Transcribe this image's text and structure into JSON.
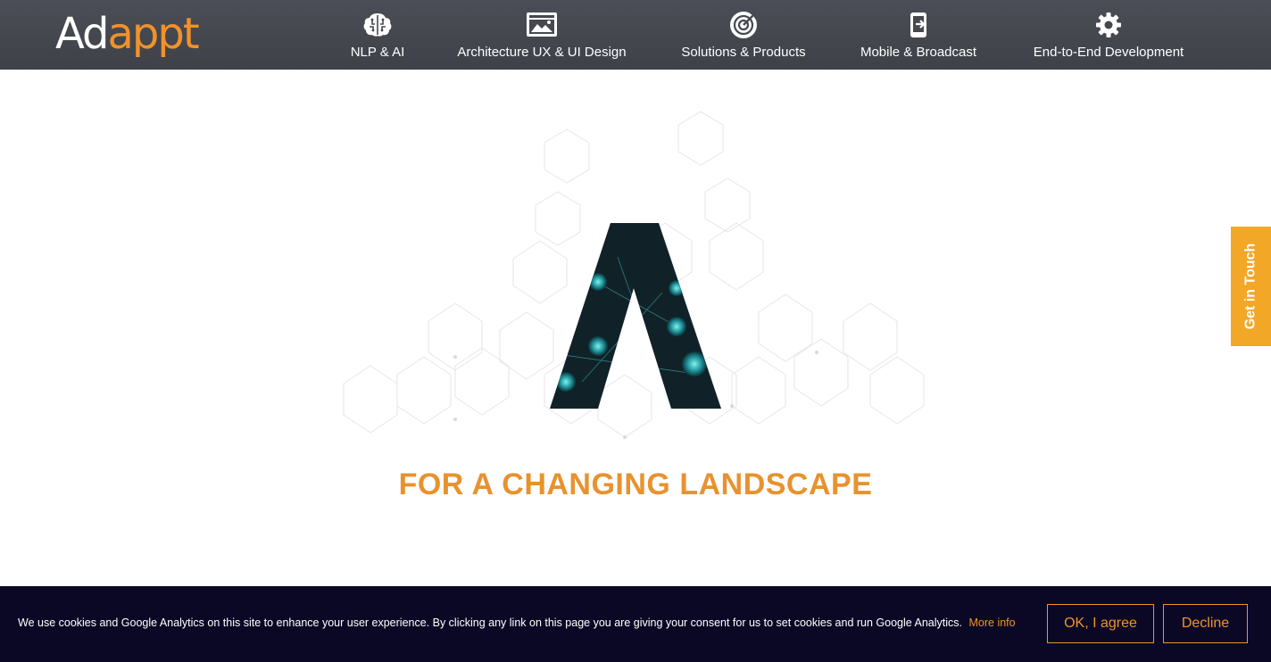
{
  "logo": {
    "part1": "Ad",
    "part2": "appt"
  },
  "nav": [
    {
      "label": "NLP & AI",
      "icon": "brain-icon"
    },
    {
      "label": "Architecture UX & UI Design",
      "icon": "monitor-design-icon"
    },
    {
      "label": "Solutions & Products",
      "icon": "target-icon"
    },
    {
      "label": "Mobile & Broadcast",
      "icon": "mobile-exit-icon"
    },
    {
      "label": "End-to-End Development",
      "icon": "gear-icon"
    }
  ],
  "hero": {
    "tagline": "FOR A CHANGING LANDSCAPE"
  },
  "side_tab": {
    "label": "Get in Touch"
  },
  "cookie": {
    "text": "We use cookies and Google Analytics on this site to enhance your user experience. By clicking any link on this page you are giving your consent for us to set cookies and run Google Analytics.",
    "more_info": "More info",
    "agree": "OK, I agree",
    "decline": "Decline"
  },
  "colors": {
    "accent": "#f0922b",
    "header_bg": "#45484f",
    "cookie_bg": "#0b0826",
    "side_tab_bg": "#f2a727"
  }
}
